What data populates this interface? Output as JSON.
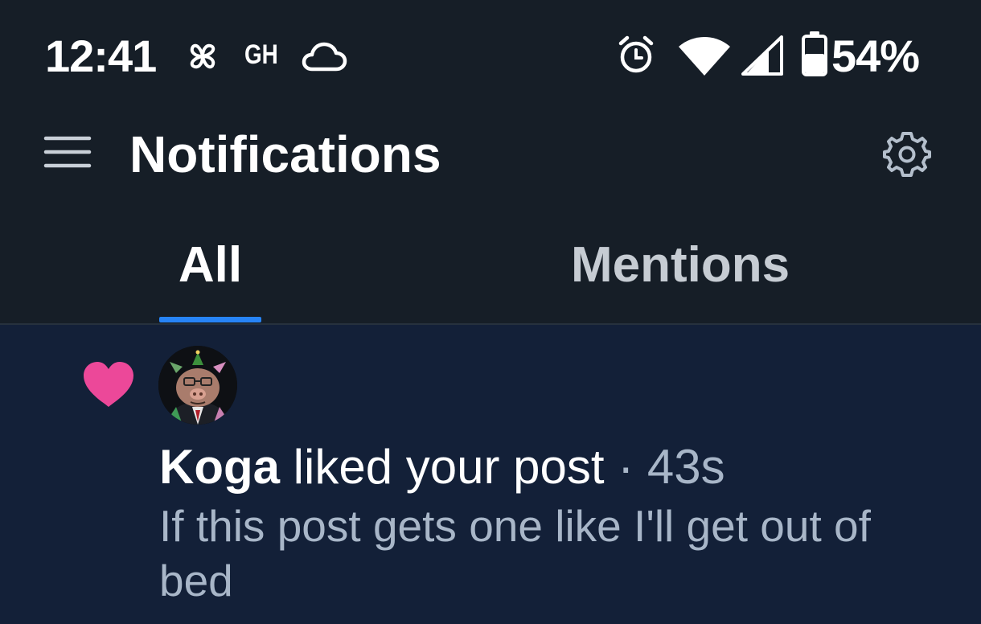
{
  "status_bar": {
    "time": "12:41",
    "indicator_text": "GH",
    "battery_percent": "54%"
  },
  "app_bar": {
    "title": "Notifications"
  },
  "tabs": [
    {
      "label": "All",
      "selected": true
    },
    {
      "label": "Mentions",
      "selected": false
    }
  ],
  "notifications": [
    {
      "type": "like",
      "icon": "heart-icon",
      "author": "Koga",
      "action": "liked your post",
      "separator": "·",
      "time_ago": "43s",
      "post_text": "If this post gets one like I'll get out of bed"
    }
  ],
  "colors": {
    "background": "#161e27",
    "notification_bg": "#132038",
    "accent": "#2784f6",
    "heart": "#ec4899",
    "muted_text": "#a8b6c8"
  }
}
